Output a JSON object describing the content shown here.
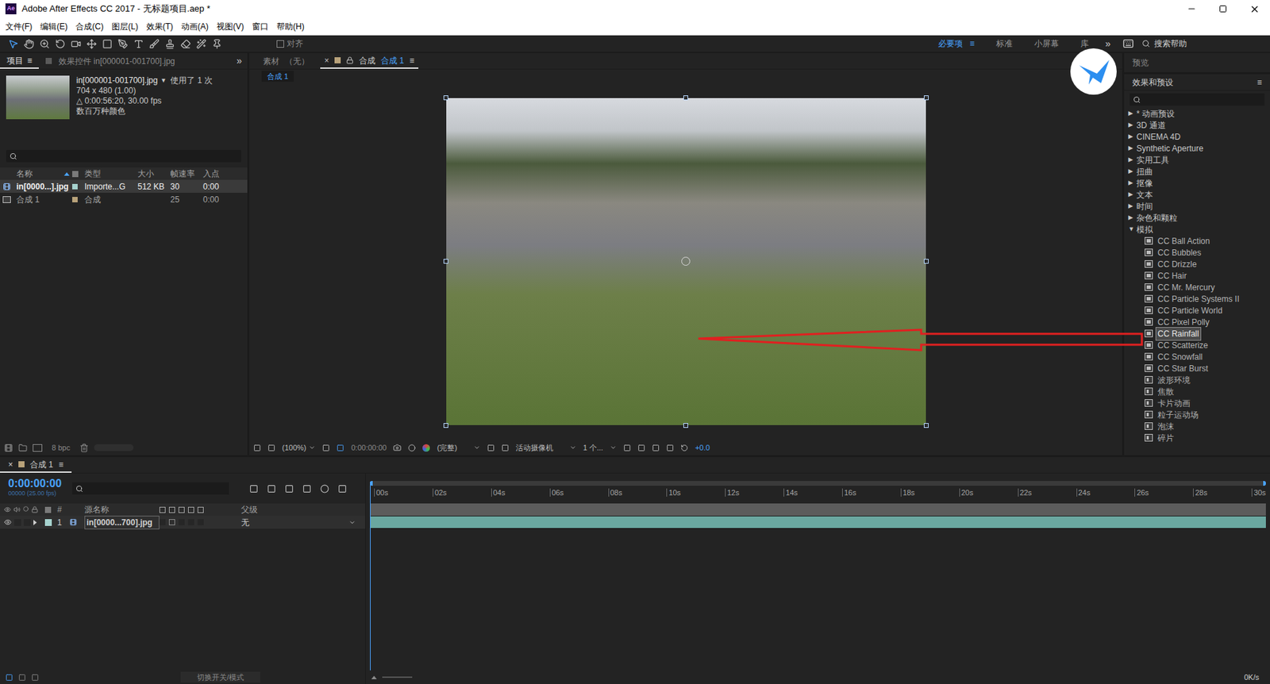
{
  "window": {
    "title": "Adobe After Effects CC 2017 - 无标题项目.aep *",
    "app_icon": "Ae"
  },
  "menu": [
    "文件(F)",
    "编辑(E)",
    "合成(C)",
    "图层(L)",
    "效果(T)",
    "动画(A)",
    "视图(V)",
    "窗口",
    "帮助(H)"
  ],
  "toolbar": {
    "snap": {
      "label": "对齐",
      "checked": false
    },
    "workspaces": [
      {
        "label": "必要项",
        "selected": true
      },
      {
        "label": "标准",
        "selected": false
      },
      {
        "label": "小屏幕",
        "selected": false
      },
      {
        "label": "库",
        "selected": false
      }
    ],
    "menu": "≡",
    "more": "»",
    "search": {
      "placeholder": "搜索帮助"
    }
  },
  "project": {
    "tabs": [
      {
        "label": "项目",
        "selected": true
      },
      {
        "label": "效果控件 in[000001-001700].jpg",
        "selected": false
      }
    ],
    "menu": "≡",
    "more": "»",
    "footage": {
      "name": "in[000001-001700].jpg",
      "dropdown": "▼",
      "usage": "使用了 1 次",
      "dimensions": "704 x 480 (1.00)",
      "duration": "△ 0:00:56:20, 30.00 fps",
      "colors": "数百万种颜色"
    },
    "columns": {
      "name": "名称",
      "type": "类型",
      "size": "大小",
      "fps": "帧速率",
      "in": "入点"
    },
    "rows": [
      {
        "name": "in[0000...].jpg",
        "type": "Importe...G",
        "size": "512 KB",
        "fps": "30",
        "in": "0:00",
        "kind": "footage",
        "selected": true,
        "color": "#a7d3cf"
      },
      {
        "name": "合成 1",
        "type": "合成",
        "size": "",
        "fps": "25",
        "in": "0:00",
        "kind": "comp",
        "selected": false,
        "color": "#b8a27a"
      }
    ],
    "bpc": "8 bpc"
  },
  "viewer": {
    "tabs": [
      {
        "prefix": "素材",
        "label": "（无）",
        "selected": false
      },
      {
        "prefix": "合成",
        "label": "合成 1",
        "selected": true
      }
    ],
    "close": "×",
    "menu": "≡",
    "breadcrumb": "合成 1",
    "controls": {
      "zoom": "(100%)",
      "time": "0:00:00:00",
      "resolution": "(完整)",
      "camera": "活动摄像机",
      "views": "1 个...",
      "exposure": "+0.0"
    }
  },
  "effects": {
    "preview": {
      "label": "预览",
      "expanded": false
    },
    "title": "效果和预设",
    "menu": "≡",
    "arrows": {
      "collapsed": "▶",
      "expanded": "▼"
    },
    "tree": [
      {
        "label": "* 动画预设",
        "expanded": false
      },
      {
        "label": "3D 通道",
        "expanded": false
      },
      {
        "label": "CINEMA 4D",
        "expanded": false
      },
      {
        "label": "Synthetic Aperture",
        "expanded": false
      },
      {
        "label": "实用工具",
        "expanded": false
      },
      {
        "label": "扭曲",
        "expanded": false
      },
      {
        "label": "抠像",
        "expanded": false
      },
      {
        "label": "文本",
        "expanded": false
      },
      {
        "label": "时间",
        "expanded": false
      },
      {
        "label": "杂色和颗粒",
        "expanded": false
      },
      {
        "label": "模拟",
        "expanded": true,
        "children": [
          {
            "label": "CC Ball Action",
            "selected": false
          },
          {
            "label": "CC Bubbles",
            "selected": false
          },
          {
            "label": "CC Drizzle",
            "selected": false
          },
          {
            "label": "CC Hair",
            "selected": false
          },
          {
            "label": "CC Mr. Mercury",
            "selected": false
          },
          {
            "label": "CC Particle Systems II",
            "selected": false
          },
          {
            "label": "CC Particle World",
            "selected": false
          },
          {
            "label": "CC Pixel Polly",
            "selected": false
          },
          {
            "label": "CC Rainfall",
            "selected": true
          },
          {
            "label": "CC Scatterize",
            "selected": false
          },
          {
            "label": "CC Snowfall",
            "selected": false
          },
          {
            "label": "CC Star Burst",
            "selected": false
          },
          {
            "label": "波形环境",
            "selected": false
          },
          {
            "label": "焦散",
            "selected": false
          },
          {
            "label": "卡片动画",
            "selected": false
          },
          {
            "label": "粒子运动场",
            "selected": false
          },
          {
            "label": "泡沫",
            "selected": false
          },
          {
            "label": "碎片",
            "selected": false
          }
        ]
      }
    ]
  },
  "timeline": {
    "tab": "合成 1",
    "close": "×",
    "menu": "≡",
    "time": "0:00:00:00",
    "frames": "00000 (25.00 fps)",
    "columns": {
      "number": "#",
      "source": "源名称",
      "parent": "父级"
    },
    "layers": [
      {
        "number": "1",
        "name": "in[0000...700].jpg",
        "parent": "无",
        "visible": true,
        "color": "#a7d3cf"
      }
    ],
    "ruler": [
      "00s",
      "02s",
      "04s",
      "06s",
      "08s",
      "10s",
      "12s",
      "14s",
      "16s",
      "18s",
      "20s",
      "22s",
      "24s",
      "26s",
      "28s",
      "30s"
    ],
    "toggle": "切换开关/模式"
  },
  "status": "0K/s"
}
